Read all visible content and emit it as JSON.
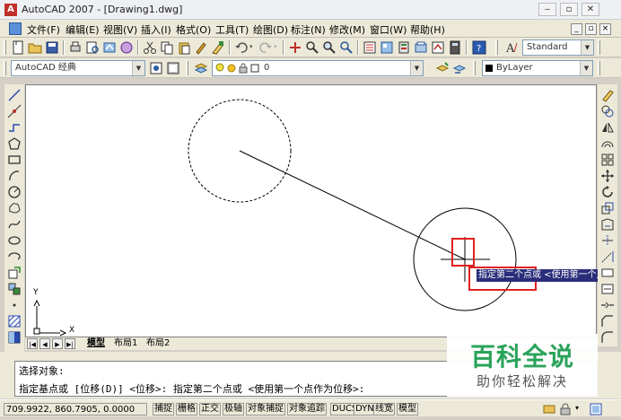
{
  "window": {
    "title": "AutoCAD 2007 - [Drawing1.dwg]",
    "app_icon_label": "A",
    "minimize": "‒",
    "restore": "▫",
    "close": "✕"
  },
  "menu": {
    "items": [
      "文件(F)",
      "编辑(E)",
      "视图(V)",
      "插入(I)",
      "格式(O)",
      "工具(T)",
      "绘图(D)",
      "标注(N)",
      "修改(M)",
      "窗口(W)",
      "帮助(H)"
    ],
    "mdi_min": "_",
    "mdi_restore": "▫",
    "mdi_close": "×"
  },
  "toolbars": {
    "text_style": "Standard",
    "workspace": "AutoCAD 经典",
    "layer": "0",
    "color": "ByLayer"
  },
  "layout_tabs": {
    "model": "模型",
    "layout1": "布局1",
    "layout2": "布局2"
  },
  "ucs": {
    "x_label": "X",
    "y_label": "Y"
  },
  "tooltip": {
    "text": "指定第二个点或 <使用第一个点作为位移>"
  },
  "command": {
    "line1": "选择对象:",
    "line2": "指定基点或 [位移(D)] <位移>:  指定第二个点或 <使用第一个点作为位移>:"
  },
  "status": {
    "coords": "709.9922, 860.7905, 0.0000",
    "buttons": [
      "捕捉",
      "栅格",
      "正交",
      "极轴",
      "对象捕捉",
      "对象追踪",
      "DUCS",
      "DYN",
      "线宽",
      "模型"
    ]
  },
  "watermark": {
    "title": "百科全说",
    "subtitle": "助你轻松解决"
  },
  "colors": {
    "highlight_box": "#e02020",
    "tooltip_bg": "#2a2e7a",
    "watermark_green": "#2aa35a"
  }
}
